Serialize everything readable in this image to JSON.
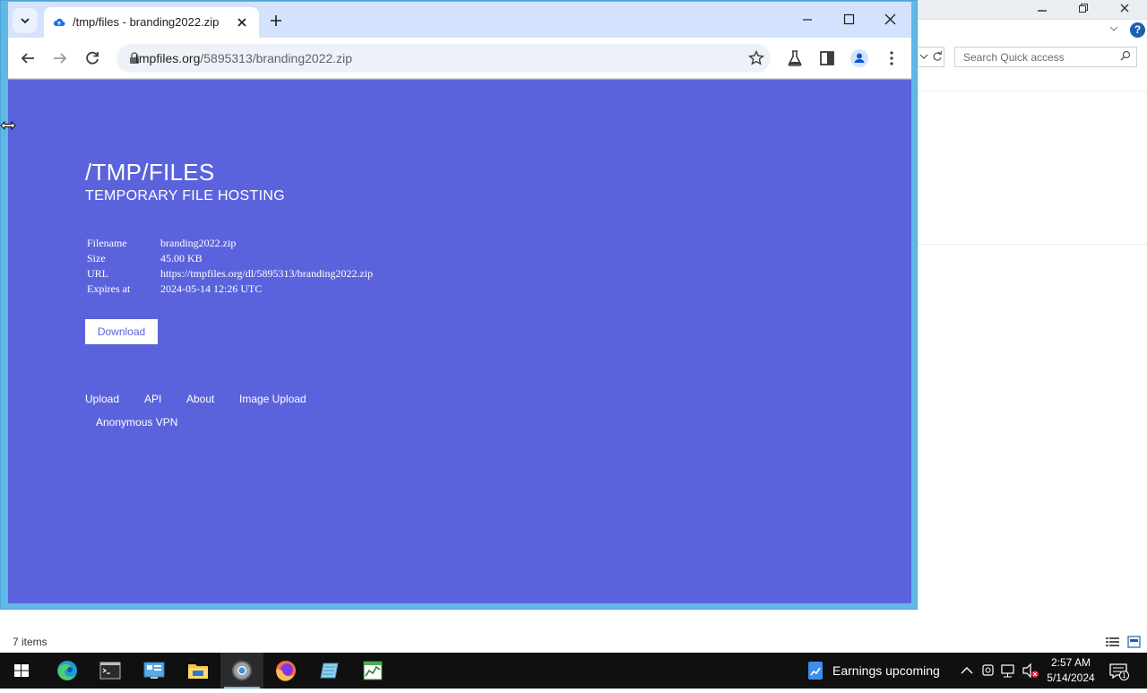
{
  "explorer": {
    "search_placeholder": "Search Quick access",
    "status_text": "7 items",
    "help_glyph": "?"
  },
  "chrome": {
    "tab": {
      "title": "/tmp/files - branding2022.zip",
      "favicon": "cloud-icon"
    },
    "omnibox": {
      "url_host": "tmpfiles.org",
      "url_path": "/5895313/branding2022.zip"
    }
  },
  "page": {
    "title": "/TMP/FILES",
    "subtitle": "TEMPORARY FILE HOSTING",
    "info_rows": [
      {
        "key": "Filename",
        "value": "branding2022.zip"
      },
      {
        "key": "Size",
        "value": "45.00 KB"
      },
      {
        "key": "URL",
        "value": "https://tmpfiles.org/dl/5895313/branding2022.zip"
      },
      {
        "key": "Expires at",
        "value": "2024-05-14 12:26 UTC"
      }
    ],
    "download_label": "Download",
    "footer_links": [
      "Upload",
      "API",
      "About",
      "Image Upload",
      "Anonymous VPN"
    ],
    "background_color": "#5b63dc"
  },
  "taskbar": {
    "apps": [
      "start",
      "edge",
      "terminal",
      "remote-desktop",
      "file-explorer",
      "chrome",
      "firefox",
      "notepad",
      "task-manager"
    ],
    "news_text": "Earnings upcoming",
    "time": "2:57 AM",
    "date": "5/14/2024",
    "notification_count": "1"
  }
}
